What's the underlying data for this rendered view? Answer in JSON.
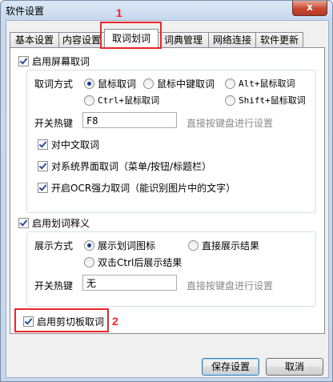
{
  "window": {
    "title": "软件设置",
    "close_symbol": "x"
  },
  "tabs": [
    {
      "label": "基本设置"
    },
    {
      "label": "内容设置"
    },
    {
      "label": "取词划词"
    },
    {
      "label": "词典管理"
    },
    {
      "label": "网络连接"
    },
    {
      "label": "软件更新"
    }
  ],
  "screen_lookup": {
    "enable_label": "启用屏幕取词",
    "method_label": "取词方式",
    "options": [
      "鼠标取词",
      "鼠标中键取词",
      "Alt+鼠标取词",
      "Ctrl+鼠标取词",
      "Shift+鼠标取词"
    ],
    "selected": "鼠标取词",
    "hotkey_label": "开关热键",
    "hotkey_value": "F8",
    "hotkey_hint": "直接按键盘进行设置",
    "chinese_label": "对中文取词",
    "ui_label": "对系统界面取词（菜单/按钮/标题栏）",
    "ocr_label": "开启OCR强力取词（能识别图片中的文字）"
  },
  "selection_translate": {
    "enable_label": "启用划词释义",
    "method_label": "展示方式",
    "options": [
      "展示划词图标",
      "直接展示结果",
      "双击Ctrl后展示结果"
    ],
    "selected": "展示划词图标",
    "hotkey_label": "开关热键",
    "hotkey_value": "无",
    "hotkey_hint": "直接按键盘进行设置"
  },
  "clipboard": {
    "enable_label": "启用剪切板取词"
  },
  "buttons": {
    "save": "保存设置",
    "cancel": "取消"
  },
  "annotations": {
    "marker1": "1",
    "marker2": "2",
    "color": "#e8262a"
  }
}
